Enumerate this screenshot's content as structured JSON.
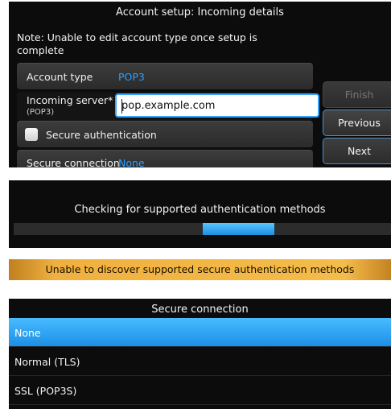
{
  "setup": {
    "title": "Account setup: Incoming details",
    "note": "Note: Unable to edit account type once setup is complete",
    "account_type_label": "Account type",
    "account_type_value": "POP3",
    "server_label": "Incoming server*",
    "server_sublabel": "(POP3)",
    "server_value": "pop.example.com",
    "secure_auth_label": "Secure authentication",
    "secure_auth_checked": false,
    "secure_conn_label": "Secure connection",
    "secure_conn_value": "None",
    "buttons": {
      "finish": "Finish",
      "previous": "Previous",
      "next": "Next"
    }
  },
  "checking": {
    "message": "Checking for supported authentication methods",
    "progress_start": 0.5,
    "progress_end": 0.69
  },
  "banner": {
    "message": "Unable to discover supported secure authentication methods"
  },
  "picker": {
    "title": "Secure connection",
    "selected_index": 0,
    "options": [
      "None",
      "Normal (TLS)",
      "SSL (POP3S)"
    ]
  },
  "colors": {
    "accent": "#2aa0ff",
    "banner": "#f0b040",
    "selection": "#2aa0ff"
  }
}
